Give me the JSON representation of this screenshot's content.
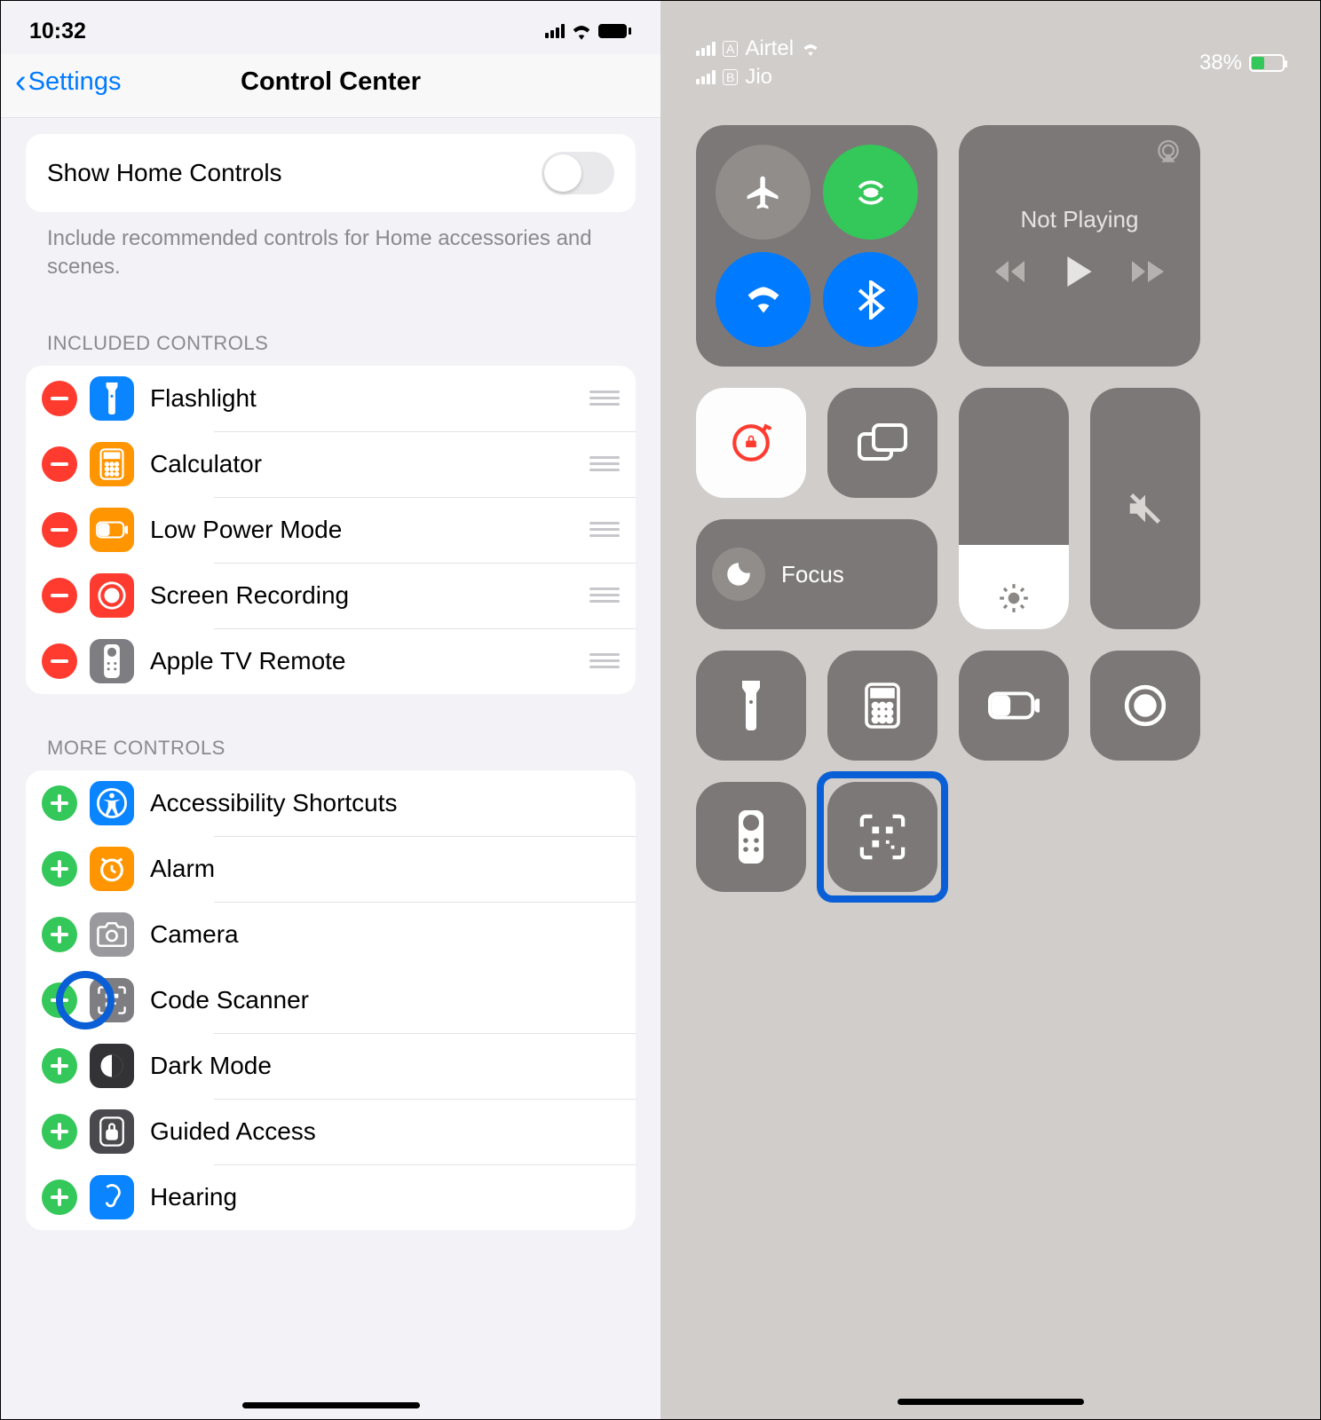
{
  "left": {
    "status": {
      "time": "10:32"
    },
    "nav": {
      "back": "Settings",
      "title": "Control Center"
    },
    "home_controls": {
      "label": "Show Home Controls",
      "caption": "Include recommended controls for Home accessories and scenes."
    },
    "sections": {
      "included_header": "INCLUDED CONTROLS",
      "more_header": "MORE CONTROLS",
      "included": [
        {
          "label": "Flashlight",
          "icon": "flashlight",
          "color": "#0a84ff"
        },
        {
          "label": "Calculator",
          "icon": "calculator",
          "color": "#ff9500"
        },
        {
          "label": "Low Power Mode",
          "icon": "battery",
          "color": "#ff9500"
        },
        {
          "label": "Screen Recording",
          "icon": "record",
          "color": "#ff3b30"
        },
        {
          "label": "Apple TV Remote",
          "icon": "remote",
          "color": "#7d7d82"
        }
      ],
      "more": [
        {
          "label": "Accessibility Shortcuts",
          "icon": "accessibility",
          "color": "#0a84ff"
        },
        {
          "label": "Alarm",
          "icon": "alarm",
          "color": "#ff9500"
        },
        {
          "label": "Camera",
          "icon": "camera",
          "color": "#9a9a9e"
        },
        {
          "label": "Code Scanner",
          "icon": "qr",
          "color": "#7d7d82",
          "highlighted": true
        },
        {
          "label": "Dark Mode",
          "icon": "dark",
          "color": "#333336"
        },
        {
          "label": "Guided Access",
          "icon": "lock-app",
          "color": "#4a4a4e"
        },
        {
          "label": "Hearing",
          "icon": "hearing",
          "color": "#0a84ff"
        }
      ]
    }
  },
  "right": {
    "status": {
      "carrier1": "Airtel",
      "carrier2": "Jio",
      "battery": "38%"
    },
    "media": {
      "label": "Not Playing"
    },
    "focus": {
      "label": "Focus"
    }
  }
}
